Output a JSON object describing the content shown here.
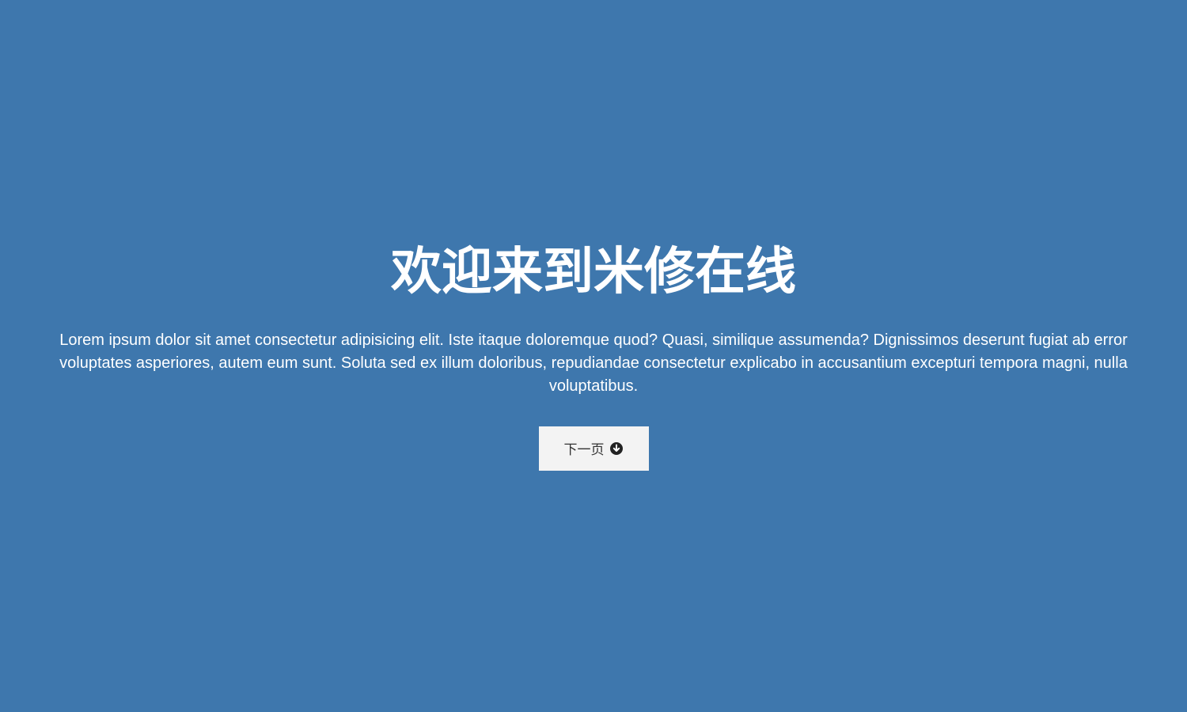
{
  "hero": {
    "title": "欢迎来到米修在线",
    "description": "Lorem ipsum dolor sit amet consectetur adipisicing elit. Iste itaque doloremque quod? Quasi, similique assumenda? Dignissimos deserunt fugiat ab error voluptates asperiores, autem eum sunt. Soluta sed ex illum doloribus, repudiandae consectetur explicabo in accusantium excepturi tempora magni, nulla voluptatibus.",
    "button": {
      "label": "下一页",
      "icon": "arrow-circle-down-icon"
    }
  },
  "colors": {
    "background": "#3e77ad",
    "text": "#ffffff",
    "button_bg": "#f3f3f3",
    "button_text": "#333333"
  }
}
